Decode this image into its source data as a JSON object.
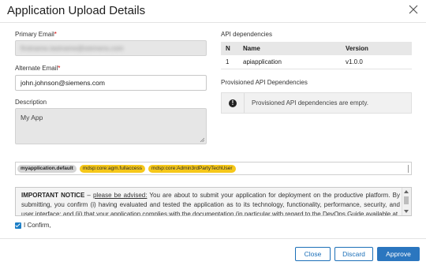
{
  "dialog": {
    "title": "Application Upload Details",
    "close_icon": "close-icon"
  },
  "form": {
    "primary_email": {
      "label": "Primary Email",
      "required_mark": "*",
      "value": "firstname.lastname@siemens.com"
    },
    "alternate_email": {
      "label": "Alternate Email",
      "required_mark": "*",
      "value": "john.johnson@siemens.com"
    },
    "description": {
      "label": "Description",
      "value": "My App"
    }
  },
  "api_dependencies": {
    "title": "API dependencies",
    "columns": [
      "N",
      "Name",
      "Version"
    ],
    "rows": [
      {
        "n": "1",
        "name": "apiapplication",
        "version": "v1.0.0"
      }
    ]
  },
  "provisioned": {
    "title": "Provisioned API Dependencies",
    "icon": "alert-icon",
    "icon_glyph": "!",
    "message": "Provisioned API dependencies are empty."
  },
  "scopes": [
    {
      "label": "myapplication.default",
      "style": "grey"
    },
    {
      "label": "mdsp:core:agm.fullaccess",
      "style": "yellow"
    },
    {
      "label": "mdsp:core:Admin3rdPartyTechUser",
      "style": "yellow"
    }
  ],
  "notice": {
    "heading": "IMPORTANT NOTICE",
    "dash": " – ",
    "advised": "please be advised:",
    "body": " You are about to submit your application for deployment on the productive platform. By submitting, you confirm (i) having evaluated and tested the application as to its technology, functionality, performance, security, and user interface; and (ii) that your application complies with the documentation (in particular with regard to the DevOps Guide available at"
  },
  "confirm": {
    "label": "I Confirm,",
    "checked": true
  },
  "buttons": {
    "close": "Close",
    "discard": "Discard",
    "approve": "Approve"
  },
  "colors": {
    "accent": "#2b76bf",
    "required": "#d00000",
    "scope_yellow": "#f6c81a"
  }
}
